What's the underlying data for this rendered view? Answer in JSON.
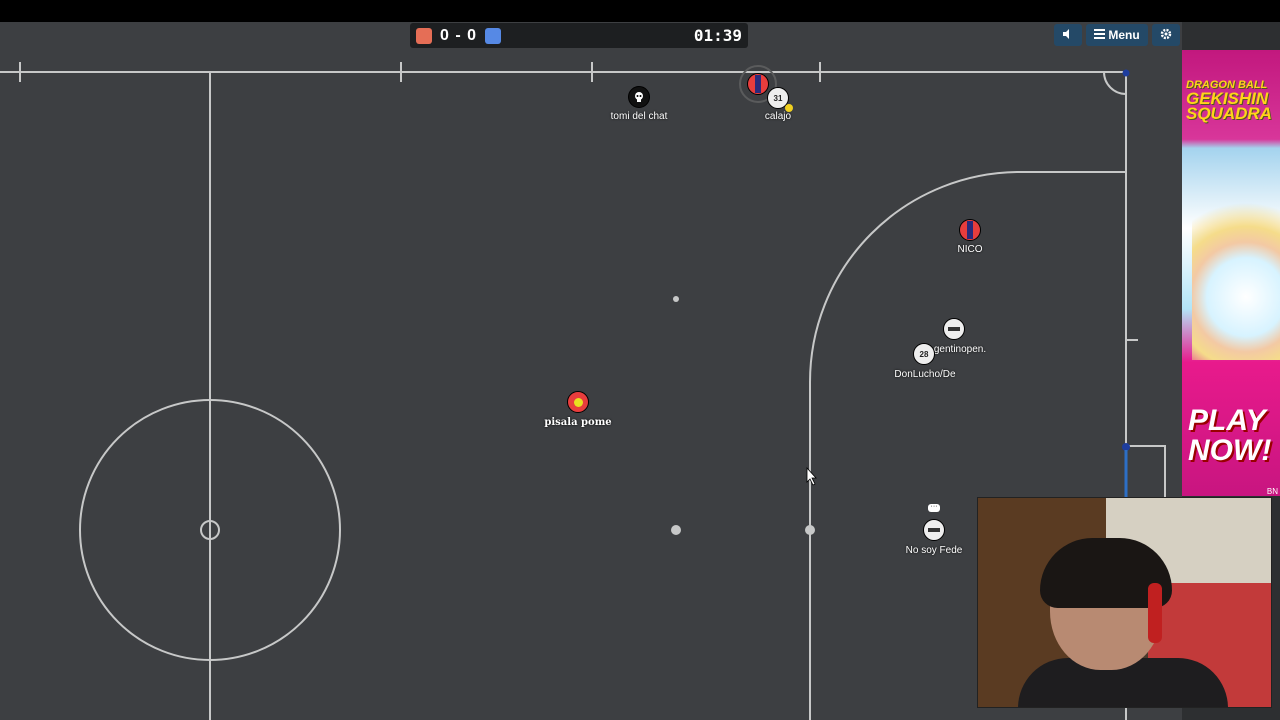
{
  "score": {
    "red_color": "#e56e56",
    "blue_color": "#5689e5",
    "red": "0",
    "separator": "-",
    "blue": "0",
    "time": "01:39"
  },
  "buttons": {
    "sound_icon": "speaker-icon",
    "menu_icon": "hamburger-icon",
    "menu_label": "Menu",
    "settings_icon": "gear-icon"
  },
  "players": {
    "tomi": {
      "name": "tomi  del chat",
      "avatar": "skull-icon"
    },
    "calajo": {
      "name": "calajo",
      "avatar": "31"
    },
    "nico": {
      "name": "NICO"
    },
    "gentinopen": {
      "name": "gentinopen."
    },
    "donlucho": {
      "name": "DonLucho/De",
      "avatar": "28"
    },
    "pisala": {
      "name": "pisala pome"
    },
    "nosoyfede": {
      "name": "No soy Fede"
    }
  },
  "ad": {
    "title_lines": [
      "DRAGON BALL",
      "GEKISHIN",
      "SQUADRA"
    ],
    "cta_line1": "PLAY",
    "cta_line2": "NOW!",
    "footer": "BN"
  },
  "colors": {
    "field": "#3d3f42",
    "lines": "#c7c8c8",
    "team_red": "#e56e56",
    "team_blue": "#5689e5"
  }
}
